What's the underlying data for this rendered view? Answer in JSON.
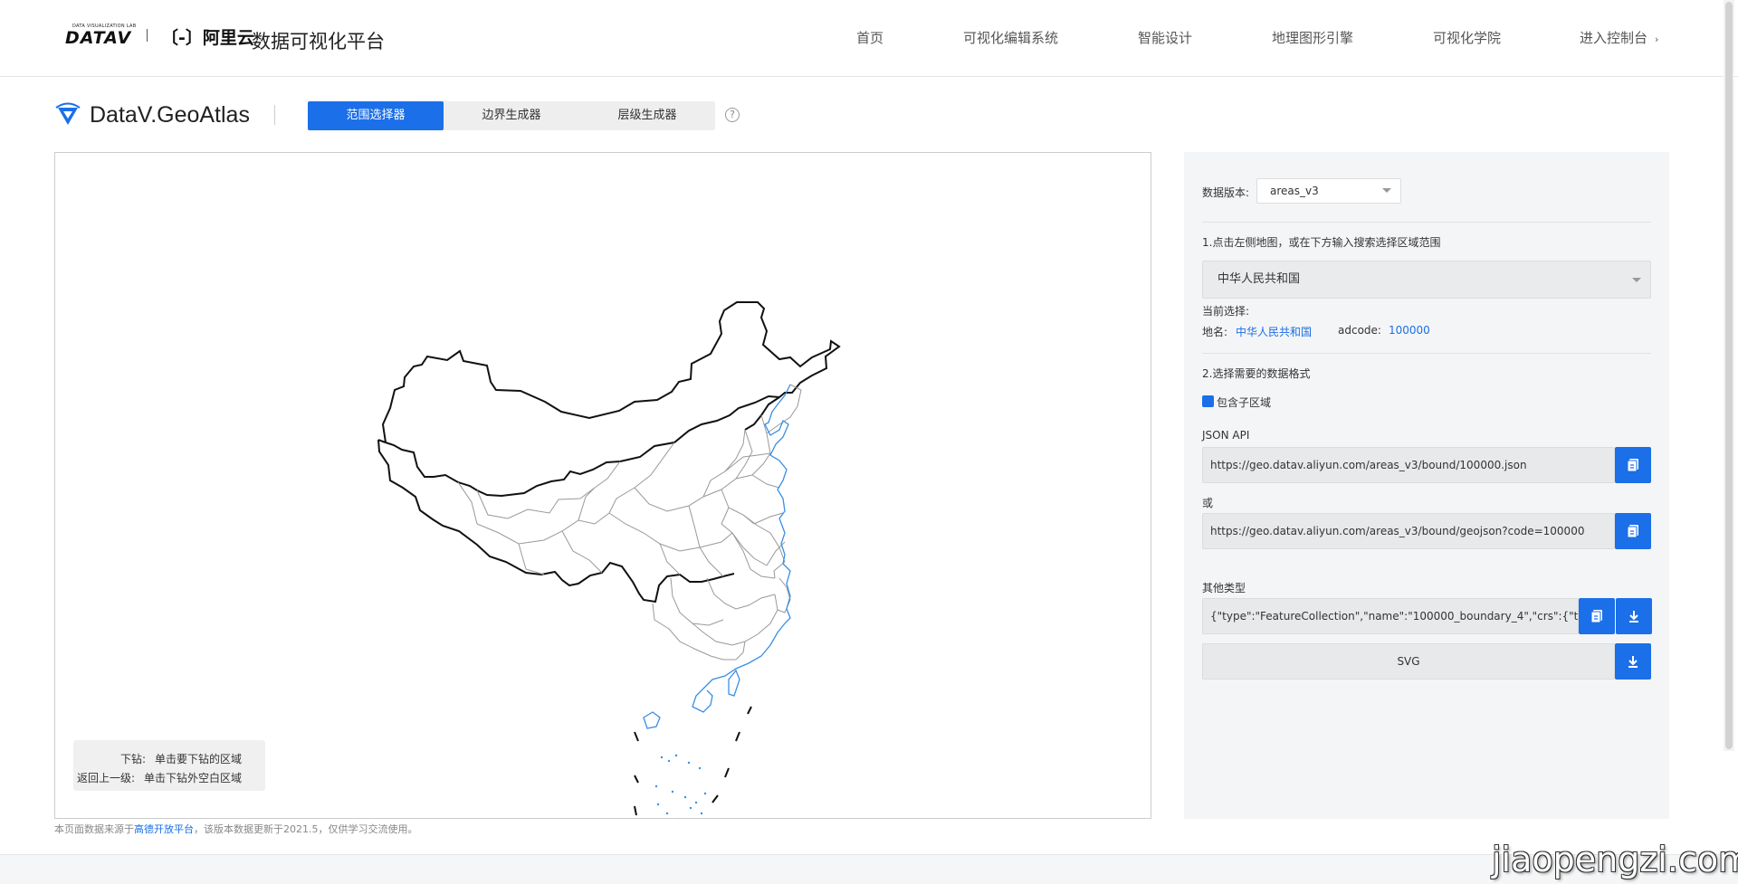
{
  "header": {
    "logo_small": "DATA VISUALIZATION LAB",
    "logo_big": "DATAV",
    "logo_aliyun": "〔-〕阿里云",
    "site_title": "数据可视化平台",
    "nav": [
      "首页",
      "可视化编辑系统",
      "智能设计",
      "地理图形引擎",
      "可视化学院",
      "进入控制台"
    ],
    "nav_chevron": "›"
  },
  "brand": {
    "name": "DataV.GeoAtlas",
    "tabs": [
      "范围选择器",
      "边界生成器",
      "层级生成器"
    ],
    "active_tab": 0,
    "help": "?"
  },
  "map": {
    "legend": [
      {
        "key": "下钻:",
        "value": "单击要下钻的区域"
      },
      {
        "key": "返回上一级:",
        "value": "单击下钻外空白区域"
      }
    ],
    "footnote_prefix": "本页面数据来源于",
    "footnote_link": "高德开放平台",
    "footnote_suffix": "，该版本数据更新于2021.5，仅供学习交流使用。"
  },
  "panel": {
    "version_label": "数据版本:",
    "version_value": "areas_v3",
    "step1": "1.点击左侧地图，或在下方输入搜索选择区域范围",
    "region_value": "中华人民共和国",
    "current_label": "当前选择:",
    "place_label": "地名:",
    "place_value": "中华人民共和国",
    "adcode_label": "adcode:",
    "adcode_value": "100000",
    "step2": "2.选择需要的数据格式",
    "include_sub_label": "包含子区域",
    "include_sub_checked": true,
    "json_api_label": "JSON API",
    "json_api_url": "https://geo.datav.aliyun.com/areas_v3/bound/100000.json",
    "or_label": "或",
    "geojson_url": "https://geo.datav.aliyun.com/areas_v3/bound/geojson?code=100000",
    "other_label": "其他类型",
    "other_value": "{\"type\":\"FeatureCollection\",\"name\":\"100000_boundary_4\",\"crs\":{\"type\":",
    "svg_label": "SVG"
  },
  "watermark": "jiaopengzi.com",
  "colors": {
    "accent": "#1b6fe8",
    "panel_bg": "#f4f5f6",
    "coast": "#3a8ee6"
  },
  "icons": {
    "copy": "copy-icon",
    "download": "download-icon",
    "help": "help-icon",
    "brand": "datav-triangle-icon"
  }
}
